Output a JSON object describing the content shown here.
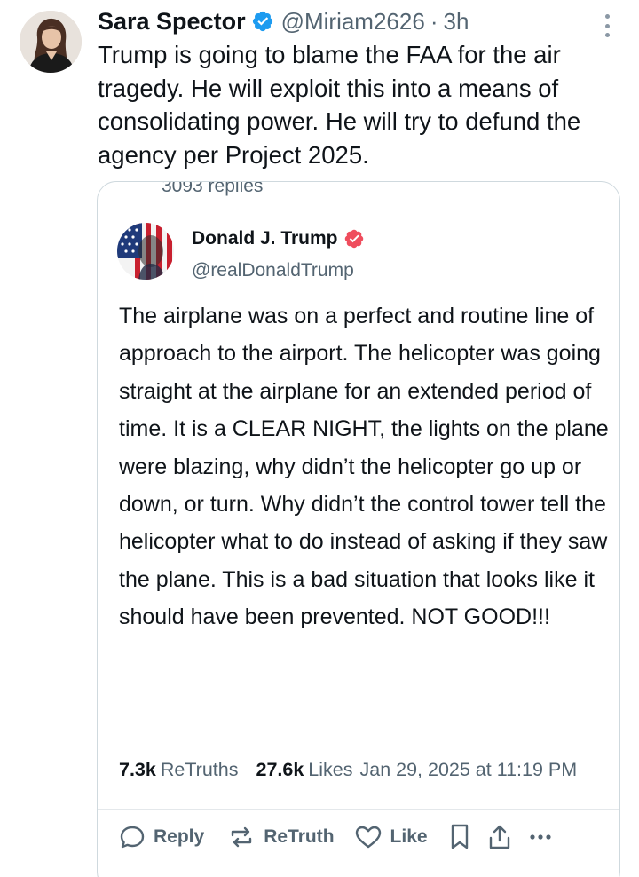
{
  "tweet": {
    "author_name": "Sara Spector",
    "handle": "@Miriam2626",
    "separator": "·",
    "time": "3h",
    "text": "Trump is going to blame the FAA for the air tragedy. He will exploit this into a means of consolidating power. He will try to defund the agency per Project 2025."
  },
  "quoted_post": {
    "replies": "3093 replies",
    "author_name": "Donald J. Trump",
    "handle": "@realDonaldTrump",
    "text": "The airplane was on a perfect and routine line of approach to the airport. The helicopter was going straight at the airplane for an extended period of time. It is a CLEAR NIGHT, the lights on the plane were blazing, why didn’t the helicopter go up or down, or turn. Why didn’t the control tower tell the helicopter what to do instead of asking if they saw the plane. This is a bad situation that looks like it should have been prevented. NOT GOOD!!!",
    "retruths_count": "7.3k",
    "retruths_label": "ReTruths",
    "likes_count": "27.6k",
    "likes_label": "Likes",
    "date": "Jan 29, 2025 at 11:19 PM",
    "actions": {
      "reply": "Reply",
      "retruth": "ReTruth",
      "like": "Like"
    }
  },
  "icons": {
    "verified": "verified-badge-icon",
    "more": "more-vertical-icon",
    "reply": "speech-bubble-icon",
    "retruth": "retruth-arrows-icon",
    "like": "heart-icon",
    "bookmark": "bookmark-icon",
    "share": "share-icon",
    "more_horizontal": "more-horizontal-icon"
  },
  "colors": {
    "text": "#0f1419",
    "secondary": "#536471",
    "verified_blue": "#1d9bf0",
    "truth_badge": "#ef4d5d",
    "border": "#cfd9de"
  }
}
